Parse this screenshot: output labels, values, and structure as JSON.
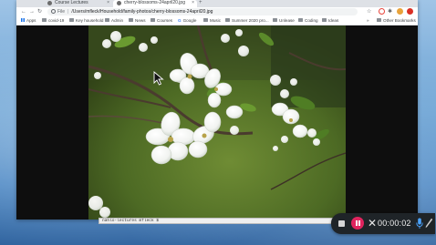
{
  "browser": {
    "tabs": [
      {
        "label": "Course Lectures"
      },
      {
        "label": "cherry-blossoms-24april20.jpg"
      }
    ],
    "new_tab": "+",
    "nav": {
      "back": "←",
      "forward": "→",
      "reload": "↻"
    },
    "address": {
      "scheme": "File",
      "separator": "|",
      "path": "/Users/mfleck/Household/family-photos/cherry-blossoms-24april20.jpg"
    },
    "bookmarks": [
      {
        "label": "Apps",
        "icon": "apps-grid-icon"
      },
      {
        "label": "covid-19",
        "icon": "folder-icon"
      },
      {
        "label": "Key household",
        "icon": "folder-icon"
      },
      {
        "label": "Admin",
        "icon": "folder-icon"
      },
      {
        "label": "News",
        "icon": "folder-icon"
      },
      {
        "label": "Courses",
        "icon": "folder-icon"
      },
      {
        "label": "Google",
        "icon": "google-icon"
      },
      {
        "label": "Music",
        "icon": "folder-icon"
      },
      {
        "label": "Summer 2020 pro...",
        "icon": "folder-icon"
      },
      {
        "label": "Unlease",
        "icon": "folder-icon"
      },
      {
        "label": "Coding",
        "icon": "folder-icon"
      },
      {
        "label": "Ideas",
        "icon": "folder-icon"
      }
    ],
    "overflow": "»",
    "other_bookmarks": "Other Bookmarks",
    "colors": {
      "accent": "#1a73e8",
      "tabstrip": "#dee1e6"
    }
  },
  "terminal": {
    "text": "nahlo-lectures mfleck $"
  },
  "recorder": {
    "time": "00:00:02",
    "colors": {
      "background": "#1f2428",
      "pause": "#e0245e",
      "mic": "#4aa3ff"
    }
  }
}
